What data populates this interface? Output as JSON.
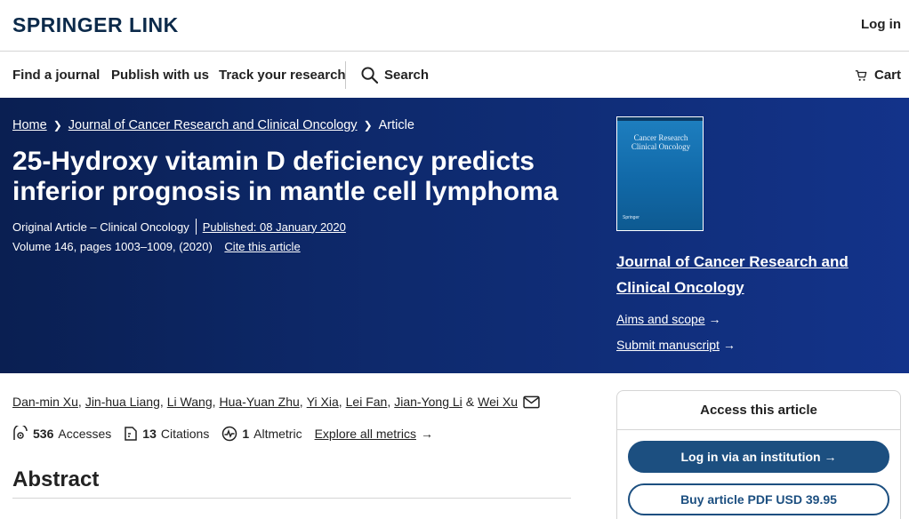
{
  "header": {
    "logo": "SPRINGER LINK",
    "login": "Log in"
  },
  "nav": {
    "items": [
      "Find a journal",
      "Publish with us",
      "Track your research"
    ],
    "search": "Search",
    "cart": "Cart"
  },
  "breadcrumb": {
    "home": "Home",
    "journal": "Journal of Cancer Research and Clinical Oncology",
    "current": "Article"
  },
  "article": {
    "title": "25-Hydroxy vitamin D deficiency predicts inferior prognosis in mantle cell lymphoma",
    "type": "Original Article – Clinical Oncology",
    "published": "Published: 08 January 2020",
    "volume": "Volume 146, pages 1003–1009, (2020)",
    "cite": "Cite this article"
  },
  "journal_panel": {
    "cover_title": "Cancer Research Clinical Oncology",
    "cover_publisher": "Springer",
    "name": "Journal of Cancer Research and Clinical Oncology",
    "aims": "Aims and scope",
    "submit": "Submit manuscript"
  },
  "authors": [
    "Dan-min Xu",
    "Jin-hua Liang",
    "Li Wang",
    "Hua-Yuan Zhu",
    "Yi Xia",
    "Lei Fan",
    "Jian-Yong Li",
    "Wei Xu"
  ],
  "authors_amp": "&",
  "metrics": {
    "accesses_count": "536",
    "accesses_label": "Accesses",
    "citations_count": "13",
    "citations_label": "Citations",
    "altmetric_count": "1",
    "altmetric_label": "Altmetric",
    "explore": "Explore all metrics"
  },
  "abstract_heading": "Abstract",
  "access": {
    "heading": "Access this article",
    "institution": "Log in via an institution",
    "buy": "Buy article PDF USD 39.95"
  },
  "colors": {
    "brand_navy": "#0c2a4a",
    "hero_blue": "#0e2a6e",
    "button_blue": "#1c4f80"
  }
}
